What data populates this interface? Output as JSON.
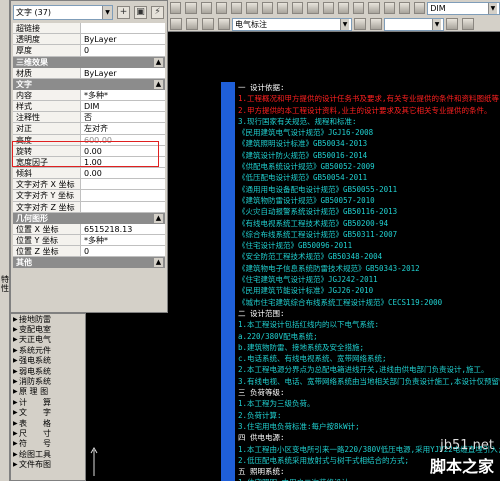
{
  "toolbar": {
    "combo_center": "电气标注",
    "combo_right": "DIM"
  },
  "palette": {
    "selector": "文字 (37)",
    "btn_toggle": "+",
    "btn_select": "▣",
    "btn_quick": "⚡",
    "sections": [
      {
        "title": "",
        "props": [
          {
            "key": "超链接",
            "value": ""
          },
          {
            "key": "透明度",
            "value": "ByLayer"
          },
          {
            "key": "厚度",
            "value": "0"
          }
        ]
      },
      {
        "title": "三维效果",
        "props": [
          {
            "key": "材质",
            "value": "ByLayer"
          }
        ]
      },
      {
        "title": "文字",
        "props": [
          {
            "key": "内容",
            "value": "*多种*"
          },
          {
            "key": "样式",
            "value": "DIM"
          },
          {
            "key": "注释性",
            "value": "否"
          },
          {
            "key": "对正",
            "value": "左对齐"
          },
          {
            "key": "高度",
            "value": "600.00"
          },
          {
            "key": "旋转",
            "value": "0.00"
          },
          {
            "key": "宽度因子",
            "value": "1.00"
          },
          {
            "key": "倾斜",
            "value": "0.00"
          },
          {
            "key": "文字对齐 X 坐标",
            "value": ""
          },
          {
            "key": "文字对齐 Y 坐标",
            "value": ""
          },
          {
            "key": "文字对齐 Z 坐标",
            "value": ""
          }
        ]
      },
      {
        "title": "几何图形",
        "props": [
          {
            "key": "位置 X 坐标",
            "value": "6515218.13"
          },
          {
            "key": "位置 Y 坐标",
            "value": "*多种*"
          },
          {
            "key": "位置 Z 坐标",
            "value": "0"
          }
        ]
      },
      {
        "title": "其他",
        "props": []
      }
    ]
  },
  "left_strip_text": "特性",
  "tools": [
    "接地防雷",
    "变配电室",
    "天正电气",
    "系统元件",
    "强电系统",
    "弱电系统",
    "消防系统",
    "原 理 图",
    "计　　算",
    "文　　字",
    "表　　格",
    "尺　　寸",
    "符　　号",
    "绘图工具",
    "文件布图"
  ],
  "drawing": {
    "lines": [
      {
        "text": "一 设计依据:",
        "color": "#ffffff"
      },
      {
        "text": "1.工程概况和甲方提供的设计任务书及要求,有关专业提供的条件和资料图纸等",
        "color": "#ff2020"
      },
      {
        "text": "2.甲方提供的本工程设计资料,业主的设计要求及其它相关专业提供的条件。",
        "color": "#ff2020"
      },
      {
        "text": "3.现行国家有关规范、规程和标准:",
        "color": "#20d0d0"
      },
      {
        "text": "《民用建筑电气设计规范》JGJ16-2008",
        "color": "#20d0d0"
      },
      {
        "text": "《建筑照明设计标准》GB50034-2013",
        "color": "#20d0d0"
      },
      {
        "text": "《建筑设计防火规范》GB50016-2014",
        "color": "#20d0d0"
      },
      {
        "text": "《供配电系统设计规范》GB50052-2009",
        "color": "#20d0d0"
      },
      {
        "text": "《低压配电设计规范》GB50054-2011",
        "color": "#20d0d0"
      },
      {
        "text": "《通用用电设备配电设计规范》GB50055-2011",
        "color": "#20d0d0"
      },
      {
        "text": "《建筑物防雷设计规范》GB50057-2010",
        "color": "#20d0d0"
      },
      {
        "text": "《火灾自动报警系统设计规范》GB50116-2013",
        "color": "#20d0d0"
      },
      {
        "text": "《有线电视系统工程技术规范》GB50200-94",
        "color": "#20d0d0"
      },
      {
        "text": "《综合布线系统工程设计规范》GB50311-2007",
        "color": "#20d0d0"
      },
      {
        "text": "《住宅设计规范》GB50096-2011",
        "color": "#20d0d0"
      },
      {
        "text": "《安全防范工程技术规范》GB50348-2004",
        "color": "#20d0d0"
      },
      {
        "text": "《建筑物电子信息系统防雷技术规范》GB50343-2012",
        "color": "#20d0d0"
      },
      {
        "text": "《住宅建筑电气设计规范》JGJ242-2011",
        "color": "#20d0d0"
      },
      {
        "text": "《民用建筑节能设计标准》JGJ26-2010",
        "color": "#20d0d0"
      },
      {
        "text": "《城市住宅建筑综合布线系统工程设计规范》CECS119:2000",
        "color": "#20d0d0"
      },
      {
        "text": "二 设计范围:",
        "color": "#ffffff"
      },
      {
        "text": "1.本工程设计包括红线内的以下电气系统:",
        "color": "#20d0d0"
      },
      {
        "text": "a.220/380V配电系统;",
        "color": "#20d0d0"
      },
      {
        "text": "b.建筑物防雷、接地系统及安全措施;",
        "color": "#20d0d0"
      },
      {
        "text": "c.电话系统、有线电视系统、宽带网络系统;",
        "color": "#20d0d0"
      },
      {
        "text": "2.本工程电源分界点为总配电箱进线开关,进线由供电部门负责设计,施工。",
        "color": "#20d0d0"
      },
      {
        "text": "3.有线电视、电话、宽带网络系统由当地相关部门负责设计施工,本设计仅预留管线。",
        "color": "#20d0d0"
      },
      {
        "text": "三 负荷等级:",
        "color": "#ffffff"
      },
      {
        "text": "1.本工程为三级负荷。",
        "color": "#20d0d0"
      },
      {
        "text": "2.负荷计算:",
        "color": "#20d0d0"
      },
      {
        "text": "3.住宅用电负荷标准:每户按8kW计;",
        "color": "#20d0d0"
      },
      {
        "text": "四 供电电源:",
        "color": "#ffffff"
      },
      {
        "text": "1.本工程由小区变电所引来一路220/380V低压电源,采用YJV22电缆直埋引入;",
        "color": "#20d0d0"
      },
      {
        "text": "2.低压配电系统采用放射式与树干式相结合的方式;",
        "color": "#20d0d0"
      },
      {
        "text": "五 照明系统:",
        "color": "#ffffff"
      },
      {
        "text": "1.住宅照明,由用户二次装修设计。",
        "color": "#20d0d0"
      }
    ]
  },
  "watermark": {
    "line1": "jb51.net",
    "line2": "脚本之家"
  }
}
